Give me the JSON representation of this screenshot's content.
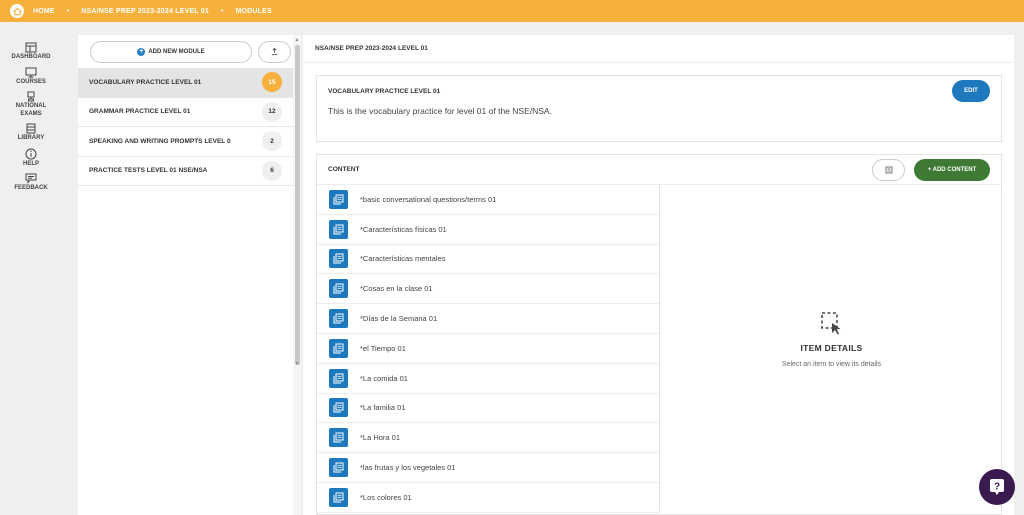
{
  "breadcrumb": {
    "items": [
      "HOME",
      "NSA/NSE PREP 2023-2024 LEVEL 01",
      "MODULES"
    ],
    "separator": "•"
  },
  "nav": {
    "items": [
      {
        "label": "DASHBOARD",
        "icon": "dashboard-icon"
      },
      {
        "label": "COURSES",
        "icon": "courses-icon"
      },
      {
        "label": "NATIONAL EXAMS",
        "icon": "exams-icon"
      },
      {
        "label": "LIBRARY",
        "icon": "library-icon"
      },
      {
        "label": "HELP",
        "icon": "info-icon"
      },
      {
        "label": "FEEDBACK",
        "icon": "feedback-icon"
      }
    ]
  },
  "modules": {
    "add_label": "ADD NEW MODULE",
    "items": [
      {
        "name": "VOCABULARY PRACTICE LEVEL 01",
        "count": "15",
        "active": true
      },
      {
        "name": "GRAMMAR PRACTICE LEVEL 01",
        "count": "12",
        "active": false
      },
      {
        "name": "SPEAKING AND WRITING PROMPTS LEVEL 0",
        "count": "2",
        "active": false
      },
      {
        "name": "PRACTICE TESTS LEVEL 01 NSE/NSA",
        "count": "6",
        "active": false
      }
    ]
  },
  "main": {
    "title": "NSA/NSE PREP 2023-2024 LEVEL 01",
    "module_card": {
      "title": "VOCABULARY PRACTICE LEVEL 01",
      "edit_label": "EDIT",
      "description": "This is the vocabulary practice for level 01 of the NSE/NSA."
    },
    "content_card": {
      "title": "CONTENT",
      "add_label": "+ ADD CONTENT",
      "items": [
        "*basic conversational questions/terms 01",
        "*Características físicas 01",
        "*Características mentales",
        "*Cosas en la clase 01",
        "*Días de la Semana 01",
        "*el Tiempo 01",
        "*La comida 01",
        "*La familia 01",
        "*La Hora 01",
        "*las frutas y los vegetales 01",
        "*Los colores 01"
      ],
      "details_title": "ITEM DETAILS",
      "details_subtitle": "Select an item to view its details"
    }
  },
  "colors": {
    "topbar": "#f7b03c",
    "primary_blue": "#1d78bd",
    "add_green": "#3e7a33",
    "help_fab": "#3b1a4f"
  }
}
